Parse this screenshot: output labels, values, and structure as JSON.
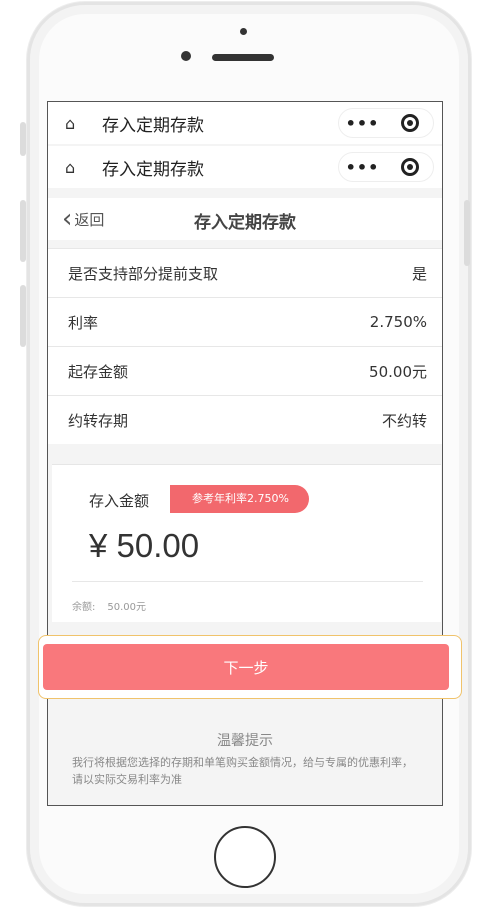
{
  "mini_program_header": {
    "home_icon": "home-icon",
    "title": "存入定期存款",
    "more_icon": "•••",
    "close_icon": "target-icon"
  },
  "nav": {
    "back_label": "返回",
    "back_icon": "chevron-left-icon",
    "title": "存入定期存款"
  },
  "info": [
    {
      "key": "是否支持部分提前支取",
      "value": "是"
    },
    {
      "key": "利率",
      "value": "2.750%"
    },
    {
      "key": "起存金额",
      "value": "50.00元"
    },
    {
      "key": "约转存期",
      "value": "不约转"
    }
  ],
  "deposit": {
    "label": "存入金额",
    "rate_badge": "参考年利率2.750%",
    "amount": "¥ 50.00",
    "balance_label": "余额:",
    "balance_value": "50.00元"
  },
  "next_button": "下一步",
  "tips": {
    "title": "温馨提示",
    "text": "我行将根据您选择的存期和单笔购买金额情况，给与专属的优惠利率，请以实际交易利率为准"
  },
  "colors": {
    "accent": "#f9787c",
    "badge": "#f2686d",
    "focus_outline": "#f0c36b"
  }
}
